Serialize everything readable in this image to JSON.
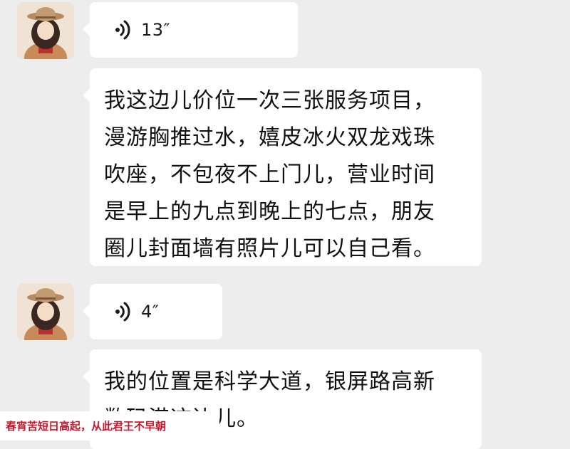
{
  "messages": [
    {
      "type": "voice",
      "duration": "13″",
      "icon": "voice-wave-icon"
    },
    {
      "type": "text",
      "text": "我这边儿价位一次三张服务项目，\n漫游胸推过水，嬉皮冰火双龙戏珠\n吹座，不包夜不上门儿，营业时间\n是早上的九点到晚上的七点，朋友\n圈儿封面墙有照片儿可以自己看。"
    },
    {
      "type": "voice",
      "duration": "4″",
      "icon": "voice-wave-icon"
    },
    {
      "type": "text",
      "text": "我的位置是科学大道，银屏路高新\n数码港这边儿。"
    }
  ],
  "watermark": "春宵苦短日高起，从此君王不早朝",
  "colors": {
    "background": "#ededed",
    "bubble": "#ffffff",
    "watermark_text": "#c8172a"
  }
}
